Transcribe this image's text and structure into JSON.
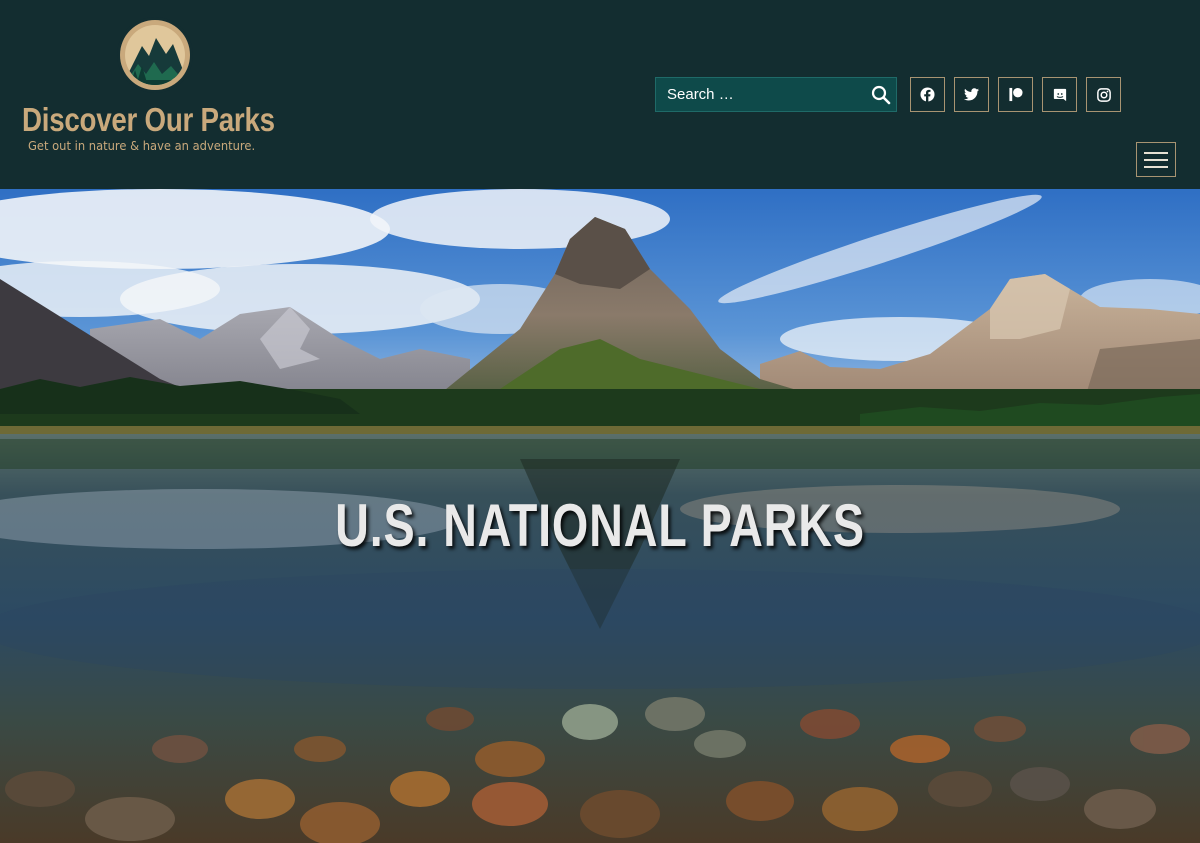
{
  "site": {
    "title": "Discover Our Parks",
    "tagline": "Get out in nature & have an adventure."
  },
  "search": {
    "placeholder": "Search …"
  },
  "social": [
    {
      "icon": "facebook-icon"
    },
    {
      "icon": "twitter-icon"
    },
    {
      "icon": "patreon-icon"
    },
    {
      "icon": "discord-icon"
    },
    {
      "icon": "instagram-icon"
    }
  ],
  "hero": {
    "title": "U.S. NATIONAL PARKS"
  },
  "colors": {
    "header_bg": "#132d30",
    "brand_tan": "#c9a97c",
    "search_bg": "#0e4a4a",
    "icon_border": "#a89472"
  }
}
